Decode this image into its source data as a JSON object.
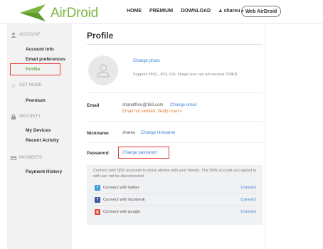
{
  "header": {
    "logo_text": "AirDroid",
    "brand_color": "#7cb342",
    "nav": [
      "HOME",
      "PREMIUM",
      "DOWNLOAD"
    ],
    "user": "shareu",
    "web_button": "Web AirDroid"
  },
  "sidebar": {
    "account_title": "ACCOUNT",
    "account_items": [
      "Account Info",
      "Email preferences",
      "Profile"
    ],
    "getmore_title": "GET MORE",
    "getmore_items": [
      "Premium"
    ],
    "security_title": "SECURITY",
    "security_items": [
      "My Devices",
      "Recent Activity"
    ],
    "payments_title": "PAYMENTS",
    "payments_items": [
      "Payment History"
    ]
  },
  "profile": {
    "title": "Profile",
    "change_photo": "Change photo",
    "support_text": "Support: PNG, JPG, GIF. Image size can not exceed 700KB.",
    "email_label": "Email",
    "email_value": "shareitforu@163.com",
    "change_email": "Change email",
    "email_warning": "Email not verified. Verify now>>",
    "nickname_label": "Nickname",
    "nickname_value": "shareu",
    "change_nickname": "Change nickname",
    "password_label": "Password",
    "change_password": "Change password"
  },
  "sns": {
    "description": "Connect with SNS accounts to share photos with your friends. The SNS account you signed in with can not be disconnected.",
    "rows": [
      {
        "label": "Connect with twitter",
        "action": "Connect",
        "icon": "twitter-icon",
        "color": "#3a9bd9"
      },
      {
        "label": "Connect with facebook",
        "action": "Connect",
        "icon": "facebook-icon",
        "color": "#3b5998"
      },
      {
        "label": "Connect with google",
        "action": "Connect",
        "icon": "google-icon",
        "color": "#dd4b39"
      }
    ]
  }
}
